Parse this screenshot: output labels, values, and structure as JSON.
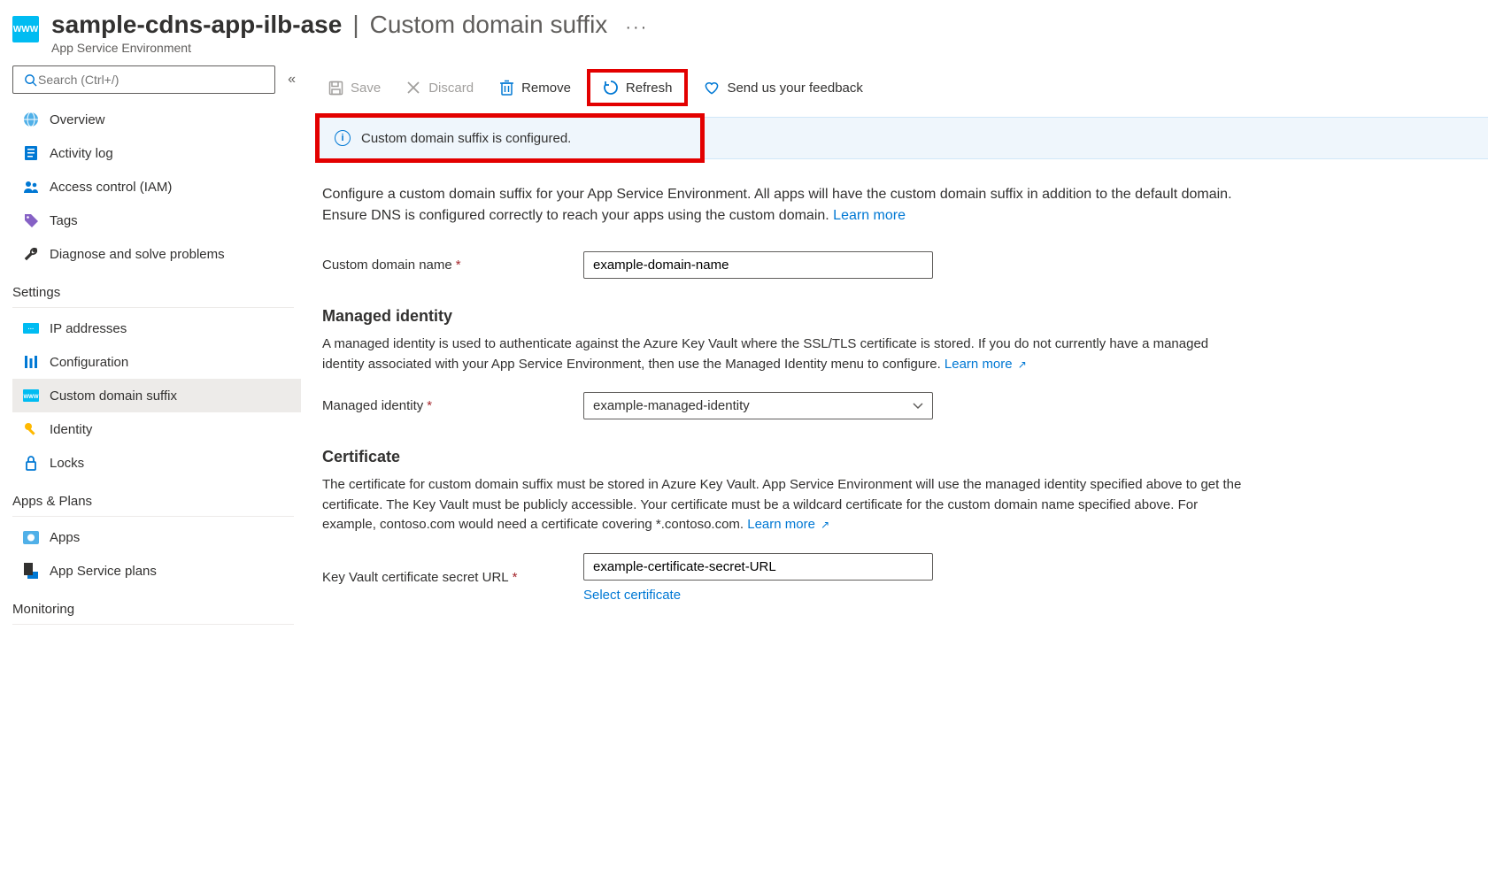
{
  "header": {
    "resource_name": "sample-cdns-app-ilb-ase",
    "separator": " | ",
    "page_title": "Custom domain suffix",
    "subtitle": "App Service Environment",
    "icon_label": "WWW"
  },
  "sidebar": {
    "search_placeholder": "Search (Ctrl+/)",
    "top_items": [
      {
        "label": "Overview",
        "icon": "globe"
      },
      {
        "label": "Activity log",
        "icon": "log"
      },
      {
        "label": "Access control (IAM)",
        "icon": "people"
      },
      {
        "label": "Tags",
        "icon": "tag"
      },
      {
        "label": "Diagnose and solve problems",
        "icon": "wrench"
      }
    ],
    "sections": [
      {
        "title": "Settings",
        "items": [
          {
            "label": "IP addresses",
            "icon": "ip"
          },
          {
            "label": "Configuration",
            "icon": "bars"
          },
          {
            "label": "Custom domain suffix",
            "icon": "www",
            "selected": true
          },
          {
            "label": "Identity",
            "icon": "key"
          },
          {
            "label": "Locks",
            "icon": "lock"
          }
        ]
      },
      {
        "title": "Apps & Plans",
        "items": [
          {
            "label": "Apps",
            "icon": "app"
          },
          {
            "label": "App Service plans",
            "icon": "plan"
          }
        ]
      },
      {
        "title": "Monitoring",
        "items": []
      }
    ]
  },
  "toolbar": {
    "save": "Save",
    "discard": "Discard",
    "remove": "Remove",
    "refresh": "Refresh",
    "feedback": "Send us your feedback"
  },
  "banner": {
    "message": "Custom domain suffix is configured."
  },
  "content": {
    "intro": "Configure a custom domain suffix for your App Service Environment. All apps will have the custom domain suffix in addition to the default domain. Ensure DNS is configured correctly to reach your apps using the custom domain. ",
    "learn_more": "Learn more",
    "custom_domain_label": "Custom domain name",
    "custom_domain_value": "example-domain-name",
    "managed_identity_heading": "Managed identity",
    "managed_identity_desc": "A managed identity is used to authenticate against the Azure Key Vault where the SSL/TLS certificate is stored. If you do not currently have a managed identity associated with your App Service Environment, then use the Managed Identity menu to configure. ",
    "managed_identity_label": "Managed identity",
    "managed_identity_value": "example-managed-identity",
    "certificate_heading": "Certificate",
    "certificate_desc": "The certificate for custom domain suffix must be stored in Azure Key Vault. App Service Environment will use the managed identity specified above to get the certificate. The Key Vault must be publicly accessible. Your certificate must be a wildcard certificate for the custom domain name specified above. For example, contoso.com would need a certificate covering *.contoso.com. ",
    "kv_secret_label": "Key Vault certificate secret URL",
    "kv_secret_value": "example-certificate-secret-URL",
    "select_certificate": "Select certificate"
  }
}
